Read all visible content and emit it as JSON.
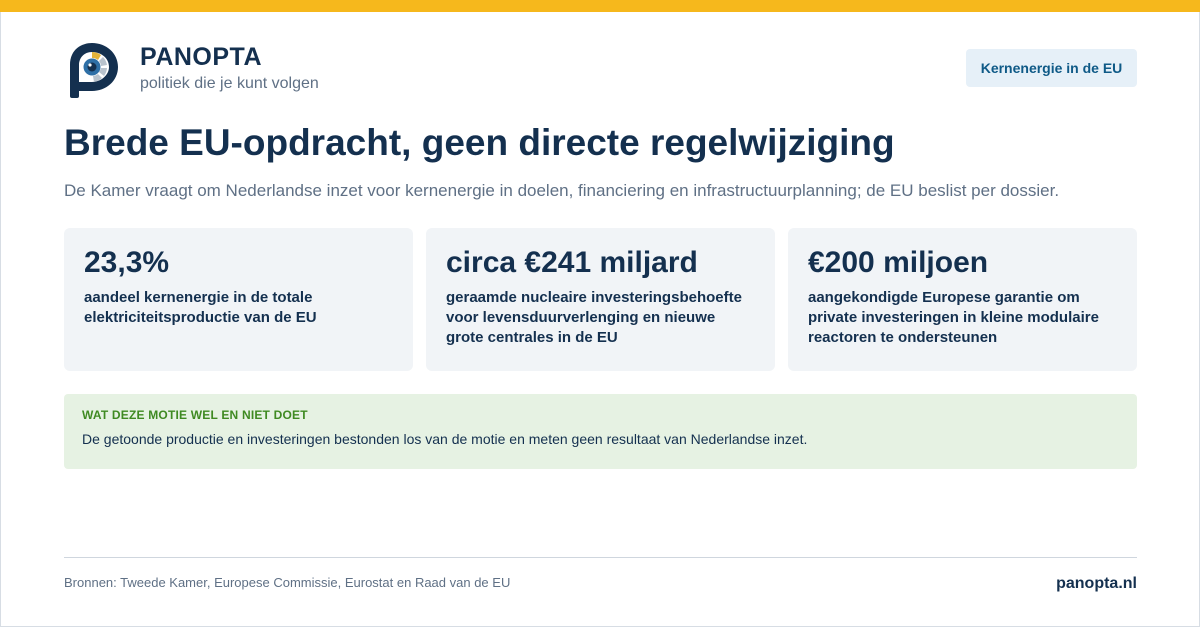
{
  "brand": {
    "name": "PANOPTA",
    "tagline": "politiek die je kunt volgen",
    "logo_icon": "eye-p-logo-icon",
    "colors": {
      "primary": "#14304f",
      "accent": "#f6b81c",
      "eye": "#2e6fa6",
      "segments": "#b9c3cd"
    }
  },
  "topic_badge": "Kernenergie in de EU",
  "headline": "Brede EU-opdracht, geen directe regelwijziging",
  "subheadline": "De Kamer vraagt om Nederlandse inzet voor kernenergie in doelen, financiering en infrastructuurplanning; de EU beslist per dossier.",
  "stats": [
    {
      "value": "23,3%",
      "description": "aandeel kernenergie in de totale elektriciteitsproductie van de EU"
    },
    {
      "value": "circa €241 miljard",
      "description": "geraamde nucleaire investeringsbehoefte voor levensduurverlenging en nieuwe grote centrales in de EU"
    },
    {
      "value": "€200 miljoen",
      "description": "aangekondigde Europese garantie om private investeringen in kleine modulaire reactoren te ondersteunen"
    }
  ],
  "note": {
    "title": "WAT DEZE MOTIE WEL EN NIET DOET",
    "text": "De getoonde productie en investeringen bestonden los van de motie en meten geen resultaat van Nederlandse inzet."
  },
  "footer": {
    "sources": "Bronnen: Tweede Kamer, Europese Commissie, Eurostat en Raad van de EU",
    "site": "panopta.nl"
  }
}
